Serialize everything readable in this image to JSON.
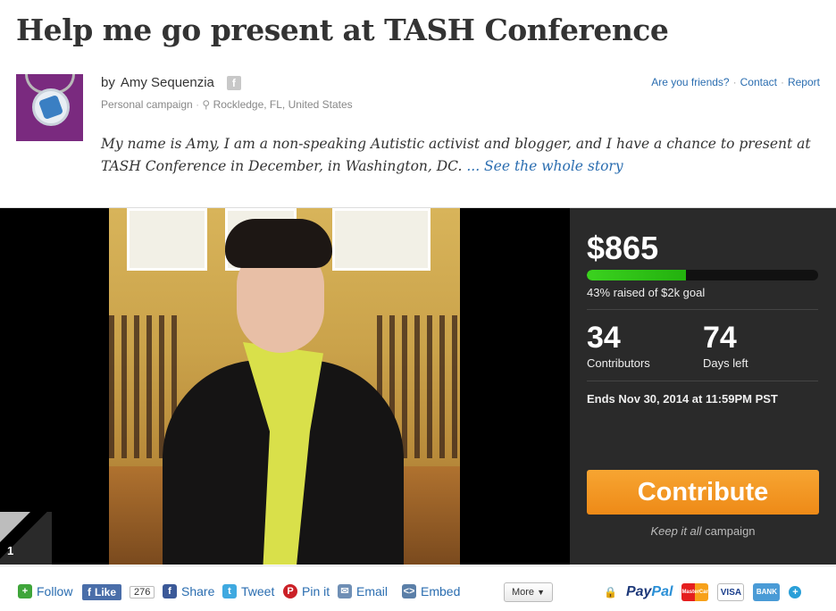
{
  "campaign": {
    "title": "Help me go present at TASH Conference",
    "by_prefix": "by",
    "author": "Amy Sequenzia",
    "fb_glyph": "f",
    "type": "Personal campaign",
    "location": "Rockledge, FL, United States",
    "story": "My name is Amy, I am a non-speaking Autistic activist and blogger, and I have a chance to present at TASH Conference in December, in Washington, DC.",
    "story_more": "... See the whole story"
  },
  "top_links": [
    "Are you friends?",
    "Contact",
    "Report"
  ],
  "gallery": {
    "index": "1"
  },
  "stats": {
    "amount": "$865",
    "progress_percent": 43,
    "raised_text": "43% raised of $2k goal",
    "contributors": "34",
    "contributors_label": "Contributors",
    "days": "74",
    "days_label": "Days left",
    "ends": "Ends Nov 30, 2014 at 11:59PM PST"
  },
  "cta": {
    "contribute": "Contribute",
    "keep_em": "Keep it all",
    "keep_rest": " campaign"
  },
  "footer": {
    "follow": "Follow",
    "like": "Like",
    "like_count": "276",
    "share": "Share",
    "tweet": "Tweet",
    "pin": "Pin it",
    "email": "Email",
    "embed": "Embed",
    "more": "More",
    "paypal_a": "Pay",
    "paypal_b": "Pal",
    "cards": [
      "MasterCard",
      "VISA",
      "BANK"
    ]
  },
  "colors": {
    "accent": "#2a6db0",
    "cta": "#f39a22",
    "progress": "#32c41a",
    "panel": "#2a2a2a"
  },
  "icons": [
    "facebook-icon",
    "pin-icon",
    "plus-icon",
    "twitter-icon",
    "pinterest-icon",
    "email-icon",
    "embed-icon",
    "lock-icon",
    "chevron-down-icon"
  ]
}
